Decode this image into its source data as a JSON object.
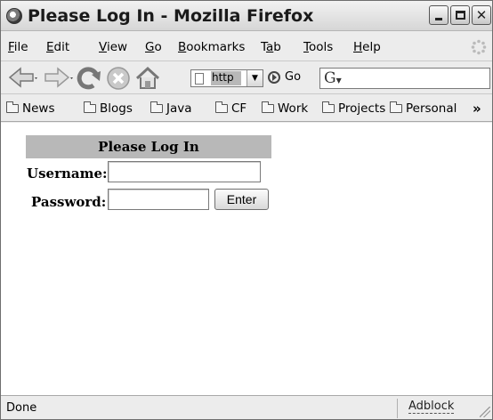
{
  "window": {
    "title": "Please Log In - Mozilla Firefox"
  },
  "menu": {
    "items": [
      {
        "label": "File",
        "accel": "F",
        "rest": "ile"
      },
      {
        "label": "Edit",
        "accel": "E",
        "rest": "dit"
      },
      {
        "label": "View",
        "accel": "V",
        "rest": "iew"
      },
      {
        "label": "Go",
        "accel": "G",
        "rest": "o"
      },
      {
        "label": "Bookmarks",
        "accel": "B",
        "rest": "ookmarks"
      },
      {
        "label": "Tab",
        "pre": "T",
        "accel": "a",
        "rest": "b"
      },
      {
        "label": "Tools",
        "accel": "T",
        "rest": "ools"
      },
      {
        "label": "Help",
        "accel": "H",
        "rest": "elp"
      }
    ]
  },
  "nav": {
    "url_text": "http",
    "go_label": "Go",
    "search_engine_glyph": "G"
  },
  "bookmarks": {
    "items": [
      "News",
      "Blogs",
      "Java",
      "CF",
      "Work",
      "Projects",
      "Personal"
    ],
    "overflow": "»"
  },
  "login": {
    "heading": "Please Log In",
    "username_label": "Username:",
    "password_label": "Password:",
    "username_value": "",
    "password_value": "",
    "submit_label": "Enter"
  },
  "status": {
    "text": "Done",
    "addon": "Adblock"
  },
  "icons": {
    "app": "firefox-icon",
    "back": "back-arrow-icon",
    "forward": "forward-arrow-icon",
    "reload": "reload-icon",
    "stop": "stop-icon",
    "home": "home-icon",
    "page": "page-icon",
    "go": "go-icon",
    "folder": "folder-icon",
    "throbber": "throbber-icon",
    "resize": "resize-grip-icon"
  }
}
